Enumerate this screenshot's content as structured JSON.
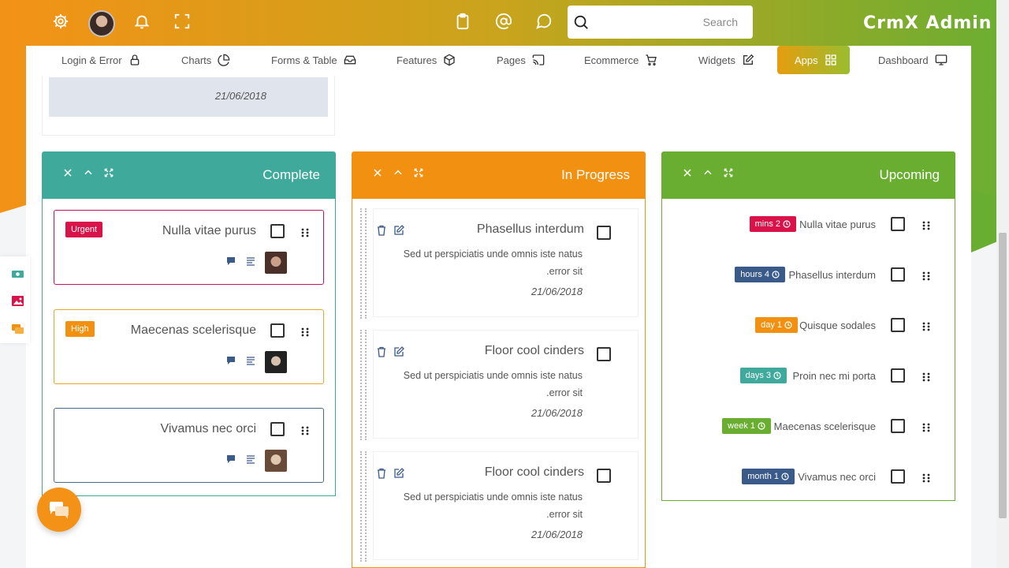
{
  "header": {
    "brand": "CrmX Admin",
    "search_placeholder": "Search",
    "icons": [
      "settings-icon",
      "avatar",
      "bell-icon",
      "fullscreen-icon",
      "clipboard-icon",
      "at-icon",
      "chat-bubble-icon"
    ]
  },
  "nav": {
    "items": [
      {
        "label": "Login & Error",
        "icon": "lock-icon"
      },
      {
        "label": "Charts",
        "icon": "pie-icon"
      },
      {
        "label": "Forms & Table",
        "icon": "inbox-icon"
      },
      {
        "label": "Features",
        "icon": "box-icon"
      },
      {
        "label": "Pages",
        "icon": "cast-icon"
      },
      {
        "label": "Ecommerce",
        "icon": "cart-icon"
      },
      {
        "label": "Widgets",
        "icon": "edit-icon"
      },
      {
        "label": "Apps",
        "icon": "grid-icon"
      },
      {
        "label": "Dashboard",
        "icon": "monitor-icon"
      }
    ],
    "active": "Apps"
  },
  "top_card": {
    "date": "21/06/2018"
  },
  "columns": {
    "complete": {
      "title": "Complete",
      "color": "#3faa9c",
      "cards": [
        {
          "badge": "Urgent",
          "badge_color": "#d9124a",
          "border": "#c0126a",
          "title": "Nulla vitae purus"
        },
        {
          "badge": "High",
          "badge_color": "#f29111",
          "border": "#e8a62a",
          "title": "Maecenas scelerisque"
        },
        {
          "badge": "",
          "badge_color": "",
          "border": "#4a6a8a",
          "title": "Vivamus nec orci"
        }
      ]
    },
    "in_progress": {
      "title": "In Progress",
      "color": "#f29111",
      "cards": [
        {
          "title": "Phasellus interdum",
          "desc_line1": "Sed ut perspiciatis unde omnis iste natus",
          "desc_line2": ".error sit",
          "date": "21/06/2018"
        },
        {
          "title": "Floor cool cinders",
          "desc_line1": "Sed ut perspiciatis unde omnis iste natus",
          "desc_line2": ".error sit",
          "date": "21/06/2018"
        },
        {
          "title": "Floor cool cinders",
          "desc_line1": "Sed ut perspiciatis unde omnis iste natus",
          "desc_line2": ".error sit",
          "date": "21/06/2018"
        }
      ]
    },
    "upcoming": {
      "title": "Upcoming",
      "color": "#6aae31",
      "rows": [
        {
          "badge": "mins 2",
          "color": "#d9124a",
          "text": "Nulla vitae purus"
        },
        {
          "badge": "hours 4",
          "color": "#3a5a8a",
          "text": "Phasellus interdum"
        },
        {
          "badge": "day 1",
          "color": "#f29111",
          "text": "Quisque sodales"
        },
        {
          "badge": "days 3",
          "color": "#3faa9c",
          "text": "Proin nec mi porta"
        },
        {
          "badge": "week 1",
          "color": "#6aae31",
          "text": "Maecenas scelerisque"
        },
        {
          "badge": "month 1",
          "color": "#3a5a8a",
          "text": "Vivamus nec orci"
        }
      ]
    }
  }
}
